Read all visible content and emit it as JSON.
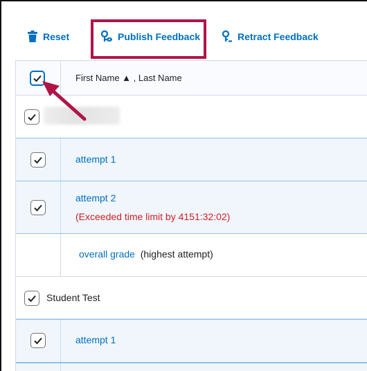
{
  "toolbar": {
    "reset_label": "Reset",
    "publish_label": "Publish Feedback",
    "retract_label": "Retract Feedback"
  },
  "table": {
    "header": {
      "name_col_label": "First Name ▲ , Last Name"
    },
    "rows": [
      {
        "type": "student",
        "name": ""
      },
      {
        "type": "attempt",
        "label": "attempt 1"
      },
      {
        "type": "attempt",
        "label": "attempt 2",
        "note": "(Exceeded time limit by 4151:32:02)"
      },
      {
        "type": "overall",
        "label": "overall grade",
        "suffix": "(highest attempt)"
      },
      {
        "type": "student",
        "name": "Student Test"
      },
      {
        "type": "attempt",
        "label": "attempt 1"
      }
    ]
  },
  "colors": {
    "link": "#006fbf",
    "highlight": "#b01547",
    "error": "#cd2026",
    "row_selected": "#f0f6fb"
  }
}
